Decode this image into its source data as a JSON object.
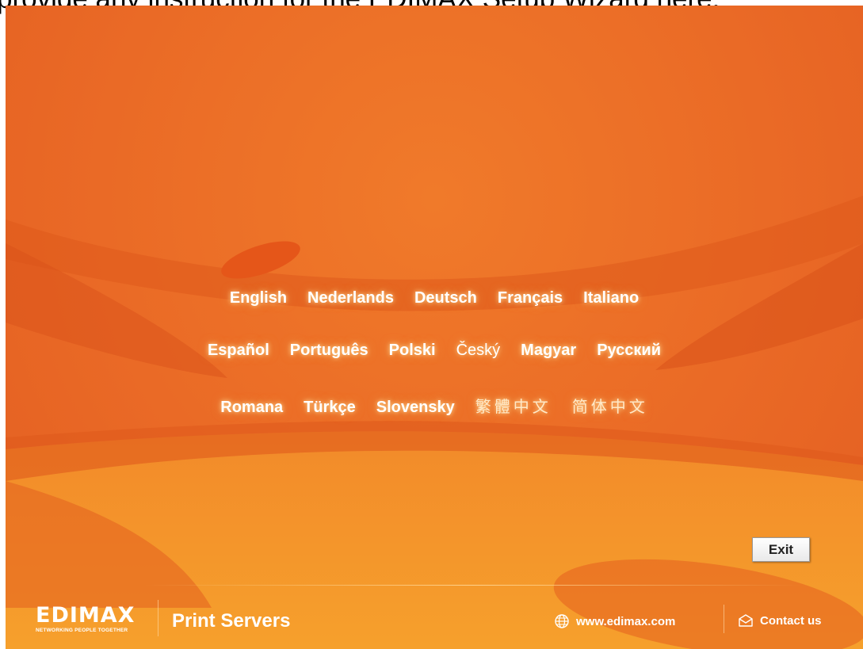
{
  "instruction_text": "provide any instruction for the EDIMAX Setup Wizard here.",
  "languages": {
    "row1": [
      "English",
      "Nederlands",
      "Deutsch",
      "Français",
      "Italiano"
    ],
    "row2": [
      "Español",
      "Português",
      "Polski",
      "Český",
      "Magyar",
      "Русский"
    ],
    "row3": [
      "Romana",
      "Türkçe",
      "Slovensky",
      "繁體中文",
      "简体中文"
    ]
  },
  "exit_label": "Exit",
  "footer": {
    "brand": "EDIMAX",
    "tagline": "NETWORKING PEOPLE TOGETHER",
    "product": "Print Servers",
    "website": "www.edimax.com",
    "contact": "Contact us"
  },
  "colors": {
    "background": "#ea6a26",
    "accent_dark": "#d9521a",
    "accent_light": "#f39a2c",
    "text": "#ffffff"
  },
  "icons": {
    "website": "globe-icon",
    "contact": "envelope-icon"
  }
}
